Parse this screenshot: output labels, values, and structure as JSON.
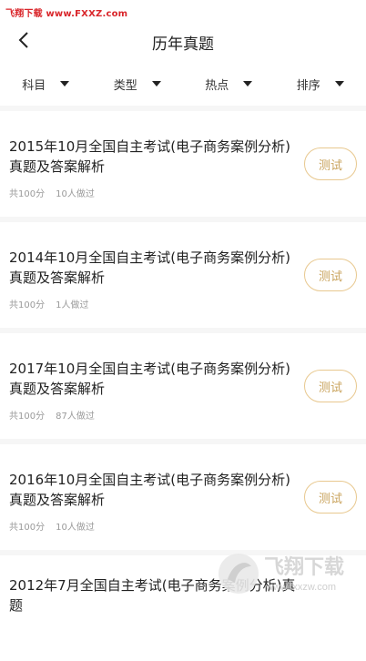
{
  "watermark": "飞翔下载 www.FXXZ.com",
  "header": {
    "title": "历年真题",
    "back_icon": "chevron-left-icon"
  },
  "filters": [
    {
      "label": "科目"
    },
    {
      "label": "类型"
    },
    {
      "label": "热点"
    },
    {
      "label": "排序"
    }
  ],
  "items": [
    {
      "title": "2015年10月全国自主考试(电子商务案例分析)真题及答案解析",
      "score": "共100分",
      "done": "10人做过",
      "action": "测试"
    },
    {
      "title": "2014年10月全国自主考试(电子商务案例分析)真题及答案解析",
      "score": "共100分",
      "done": "1人做过",
      "action": "测试"
    },
    {
      "title": "2017年10月全国自主考试(电子商务案例分析)真题及答案解析",
      "score": "共100分",
      "done": "87人做过",
      "action": "测试"
    },
    {
      "title": "2016年10月全国自主考试(电子商务案例分析)真题及答案解析",
      "score": "共100分",
      "done": "10人做过",
      "action": "测试"
    },
    {
      "title": "2012年7月全国自主考试(电子商务案例分析)真题",
      "score": "",
      "done": "",
      "action": ""
    }
  ],
  "logo_watermark": {
    "name": "飞翔下载",
    "url": "www.fxxzw.com"
  },
  "colors": {
    "accent": "#c9a35c",
    "accent_border": "#e8c88f",
    "meta": "#9a9a9a"
  }
}
